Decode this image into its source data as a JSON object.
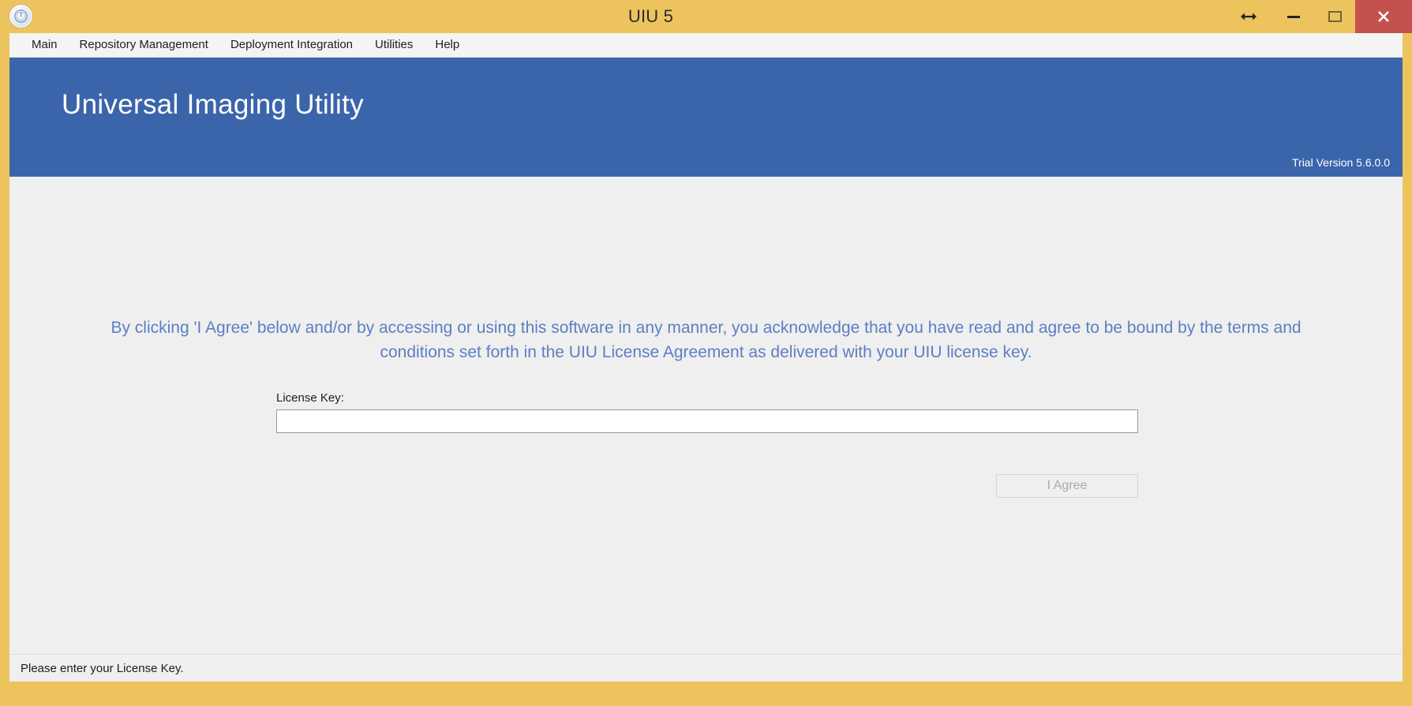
{
  "window": {
    "title": "UIU 5",
    "app_icon": "power-button-icon",
    "frame_color": "#edc35e",
    "controls": {
      "resize": "resize-horizontal-icon",
      "minimize": "minimize-icon",
      "maximize": "maximize-icon",
      "close": "✕",
      "close_color": "#c3514e"
    }
  },
  "menu": {
    "items": [
      {
        "label": "Main"
      },
      {
        "label": "Repository Management"
      },
      {
        "label": "Deployment Integration"
      },
      {
        "label": "Utilities"
      },
      {
        "label": "Help"
      }
    ]
  },
  "banner": {
    "title": "Universal Imaging Utility",
    "version": "Trial Version 5.6.0.0",
    "background_color": "#3b65ab",
    "text_color": "#ffffff"
  },
  "main": {
    "agreement_text": "By clicking 'I Agree' below and/or by accessing or using this software in any manner, you acknowledge that you have read and agree to be bound by the terms and conditions set forth in the UIU License Agreement as delivered with your UIU license key.",
    "agreement_text_color": "#5b7fc4",
    "license_key": {
      "label": "License Key:",
      "value": "",
      "placeholder": ""
    },
    "agree_button": {
      "label": "I Agree",
      "enabled": false
    }
  },
  "status_bar": {
    "message": "Please enter your License Key."
  }
}
